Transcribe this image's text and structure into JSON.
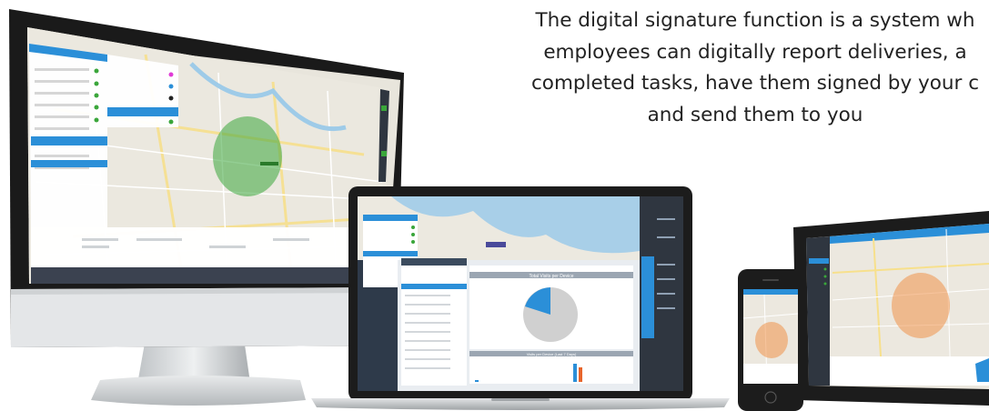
{
  "tagline": {
    "line1": "The digital signature function is a system wh",
    "line2": "employees can digitally report deliveries, a",
    "line3": "completed tasks, have them signed by your c",
    "line4": "and send them to you"
  },
  "laptop_screen": {
    "chart_header": "Total Visits per Device",
    "bar_header": "Visits per Device (Last 7 Days)"
  },
  "colors": {
    "accent": "#2b8fd8",
    "map_zone_green": "#3aa63a",
    "map_zone_orange": "#f08a3c",
    "device_frame": "#1c1c1c",
    "app_sidebar": "#2f3640"
  }
}
